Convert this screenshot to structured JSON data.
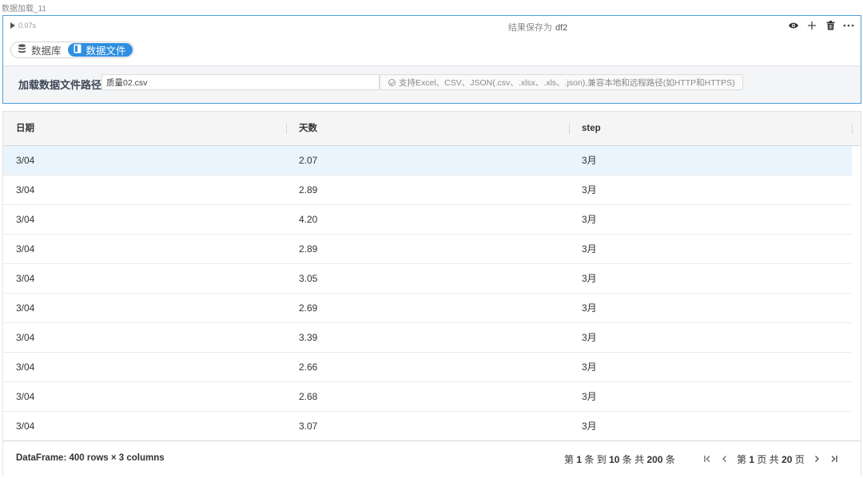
{
  "cell": {
    "title": "数据加载_11",
    "run_time": "0.07s",
    "save_as_label": "结果保存为",
    "save_as_var": "df2",
    "tabs": [
      {
        "label": "数据库",
        "icon": "database-icon",
        "active": false
      },
      {
        "label": "数据文件",
        "icon": "file-icon",
        "active": true
      }
    ],
    "path_label": "加载数据文件路径",
    "path_value": "质量02.csv",
    "hint": "支持Excel、CSV、JSON(.csv、.xlsx、.xls、.json),兼容本地和远程路径(如HTTP和HTTPS)"
  },
  "table": {
    "columns": [
      "日期",
      "天数",
      "step"
    ],
    "rows": [
      [
        "3/04",
        "2.07",
        "3月"
      ],
      [
        "3/04",
        "2.89",
        "3月"
      ],
      [
        "3/04",
        "4.20",
        "3月"
      ],
      [
        "3/04",
        "2.89",
        "3月"
      ],
      [
        "3/04",
        "3.05",
        "3月"
      ],
      [
        "3/04",
        "2.69",
        "3月"
      ],
      [
        "3/04",
        "3.39",
        "3月"
      ],
      [
        "3/04",
        "2.66",
        "3月"
      ],
      [
        "3/04",
        "2.68",
        "3月"
      ],
      [
        "3/04",
        "3.07",
        "3月"
      ]
    ],
    "highlighted_row": 0
  },
  "footer": {
    "df_info": "DataFrame: 400 rows × 3 columns",
    "range_prefix": "第",
    "range_start": "1",
    "range_mid": "条 到",
    "range_end": "10",
    "range_mid2": "条 共",
    "range_total": "200",
    "range_suffix": "条",
    "page_prefix": "第",
    "page_current": "1",
    "page_mid": "页 共",
    "page_total": "20",
    "page_suffix": "页"
  },
  "colors": {
    "accent": "#2e8fe0",
    "cell_border": "#4aa3df",
    "row_highlight": "#e9f4fd"
  }
}
